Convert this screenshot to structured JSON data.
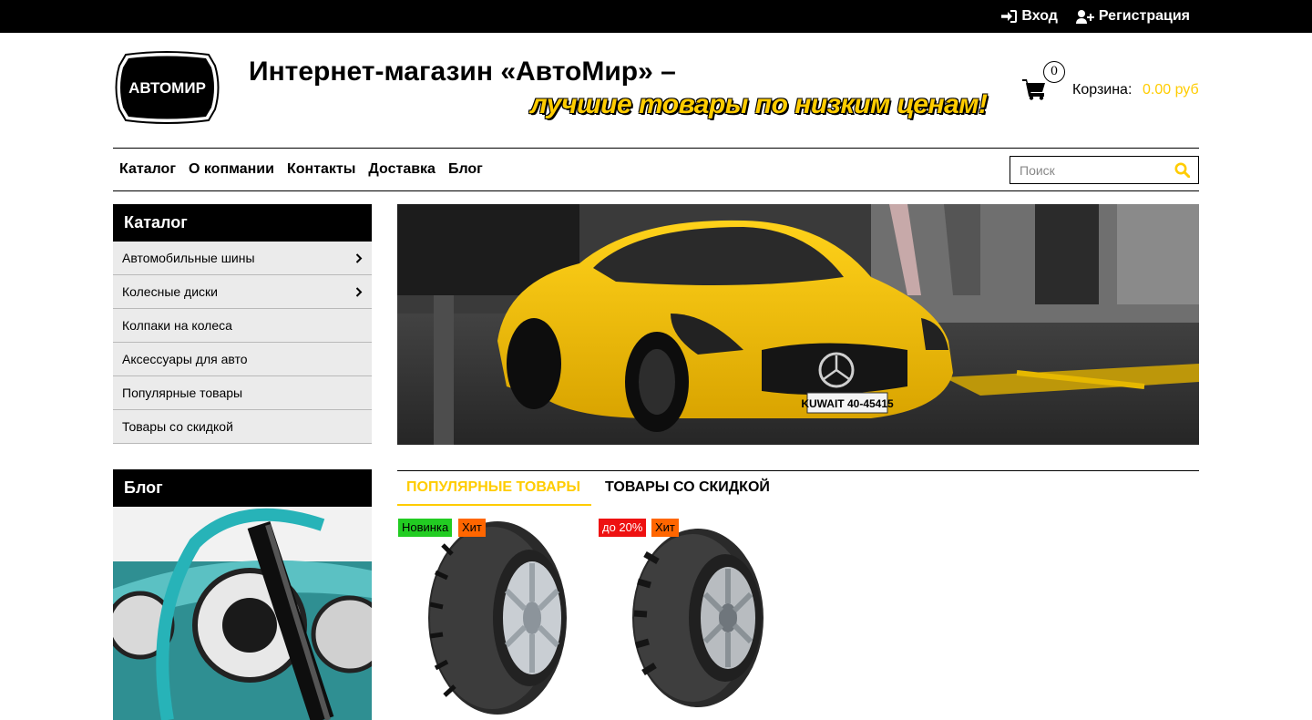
{
  "topbar": {
    "login": "Вход",
    "register": "Регистрация"
  },
  "header": {
    "logo_text": "АВТОМИР",
    "title_line1": "Интернет-магазин «АвтоМир» –",
    "title_line2": "лучшие товары по низким ценам!",
    "cart_count": "0",
    "cart_label": "Корзина:",
    "cart_sum": "0.00 руб"
  },
  "nav": {
    "items": [
      "Каталог",
      "О копмании",
      "Контакты",
      "Доставка",
      "Блог"
    ]
  },
  "search": {
    "placeholder": "Поиск"
  },
  "catalog": {
    "title": "Каталог",
    "items": [
      "Автомобильные шины",
      "Колесные диски",
      "Колпаки на колеса",
      "Аксессуары для авто",
      "Популярные товары",
      "Товары со скидкой"
    ]
  },
  "blog": {
    "title": "Блог"
  },
  "hero": {
    "plate": "KUWAIT 40-45415"
  },
  "tabs": {
    "popular": "ПОПУЛЯРНЫЕ ТОВАРЫ",
    "discount": "ТОВАРЫ СО СКИДКОЙ"
  },
  "products": [
    {
      "badges": [
        {
          "text": "Новинка",
          "color": "#22cc22"
        },
        {
          "text": "Хит",
          "color": "#ff6600"
        }
      ]
    },
    {
      "badges": [
        {
          "text": "до 20%",
          "color": "#ee1111"
        },
        {
          "text": "Хит",
          "color": "#ff6600"
        }
      ]
    }
  ],
  "colors": {
    "accent": "#ffcc00",
    "black": "#000000",
    "sidebar_bg": "#ebebeb"
  }
}
